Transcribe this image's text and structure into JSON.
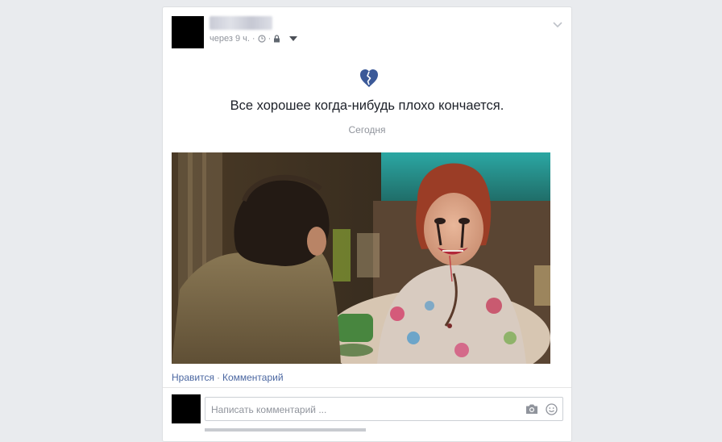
{
  "post": {
    "time": "через 9 ч.",
    "meta_sep": "·",
    "status_text": "Все хорошее когда-нибудь плохо кончается.",
    "date_label": "Сегодня",
    "heart_color": "#3b5998"
  },
  "actions": {
    "like": "Нравится",
    "sep": "·",
    "comment": "Комментарий"
  },
  "comment_box": {
    "placeholder": "Написать комментарий ..."
  },
  "icons": {
    "clock": "clock-icon",
    "lock": "lock-icon",
    "audience": "dropdown-icon",
    "chevron": "chevron-down-icon",
    "camera": "camera-icon",
    "emoji": "smiley-icon"
  }
}
